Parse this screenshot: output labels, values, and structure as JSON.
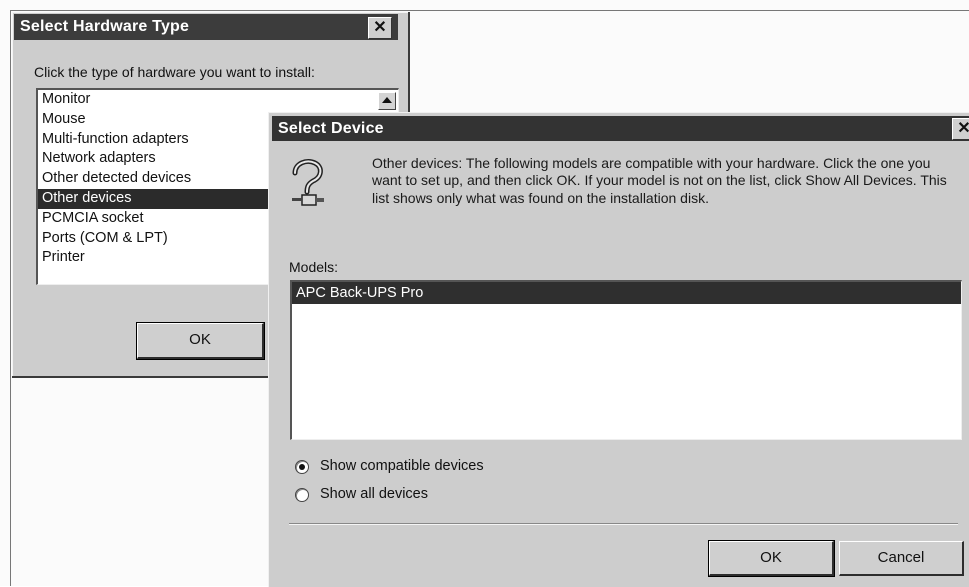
{
  "select_hardware": {
    "title": "Select Hardware Type",
    "close_label": "✕",
    "instruction": "Click the type of hardware you want to install:",
    "items": [
      {
        "label": "Monitor"
      },
      {
        "label": "Mouse"
      },
      {
        "label": "Multi-function adapters"
      },
      {
        "label": "Network adapters"
      },
      {
        "label": "Other detected devices"
      },
      {
        "label": "Other devices",
        "selected": true
      },
      {
        "label": "PCMCIA socket"
      },
      {
        "label": "Ports (COM & LPT)"
      },
      {
        "label": "Printer"
      }
    ],
    "ok_label": "OK"
  },
  "select_device": {
    "title": "Select Device",
    "close_label": "✕",
    "icon": "question-mark-icon",
    "description": "Other devices: The following models are compatible with your hardware. Click the one you want to set up, and then click OK. If your model is not on the list, click Show All Devices. This list shows only what was found on the installation disk.",
    "models_label": "Models:",
    "models": [
      {
        "label": "APC Back-UPS Pro",
        "selected": true
      }
    ],
    "radio_options": [
      {
        "label": "Show compatible devices",
        "checked": true
      },
      {
        "label": "Show all devices",
        "checked": false
      }
    ],
    "ok_label": "OK",
    "cancel_label": "Cancel"
  },
  "colors": {
    "selection": "#2f2f2f",
    "dialog_face": "#cdcdcd",
    "titlebar": "#333333"
  }
}
